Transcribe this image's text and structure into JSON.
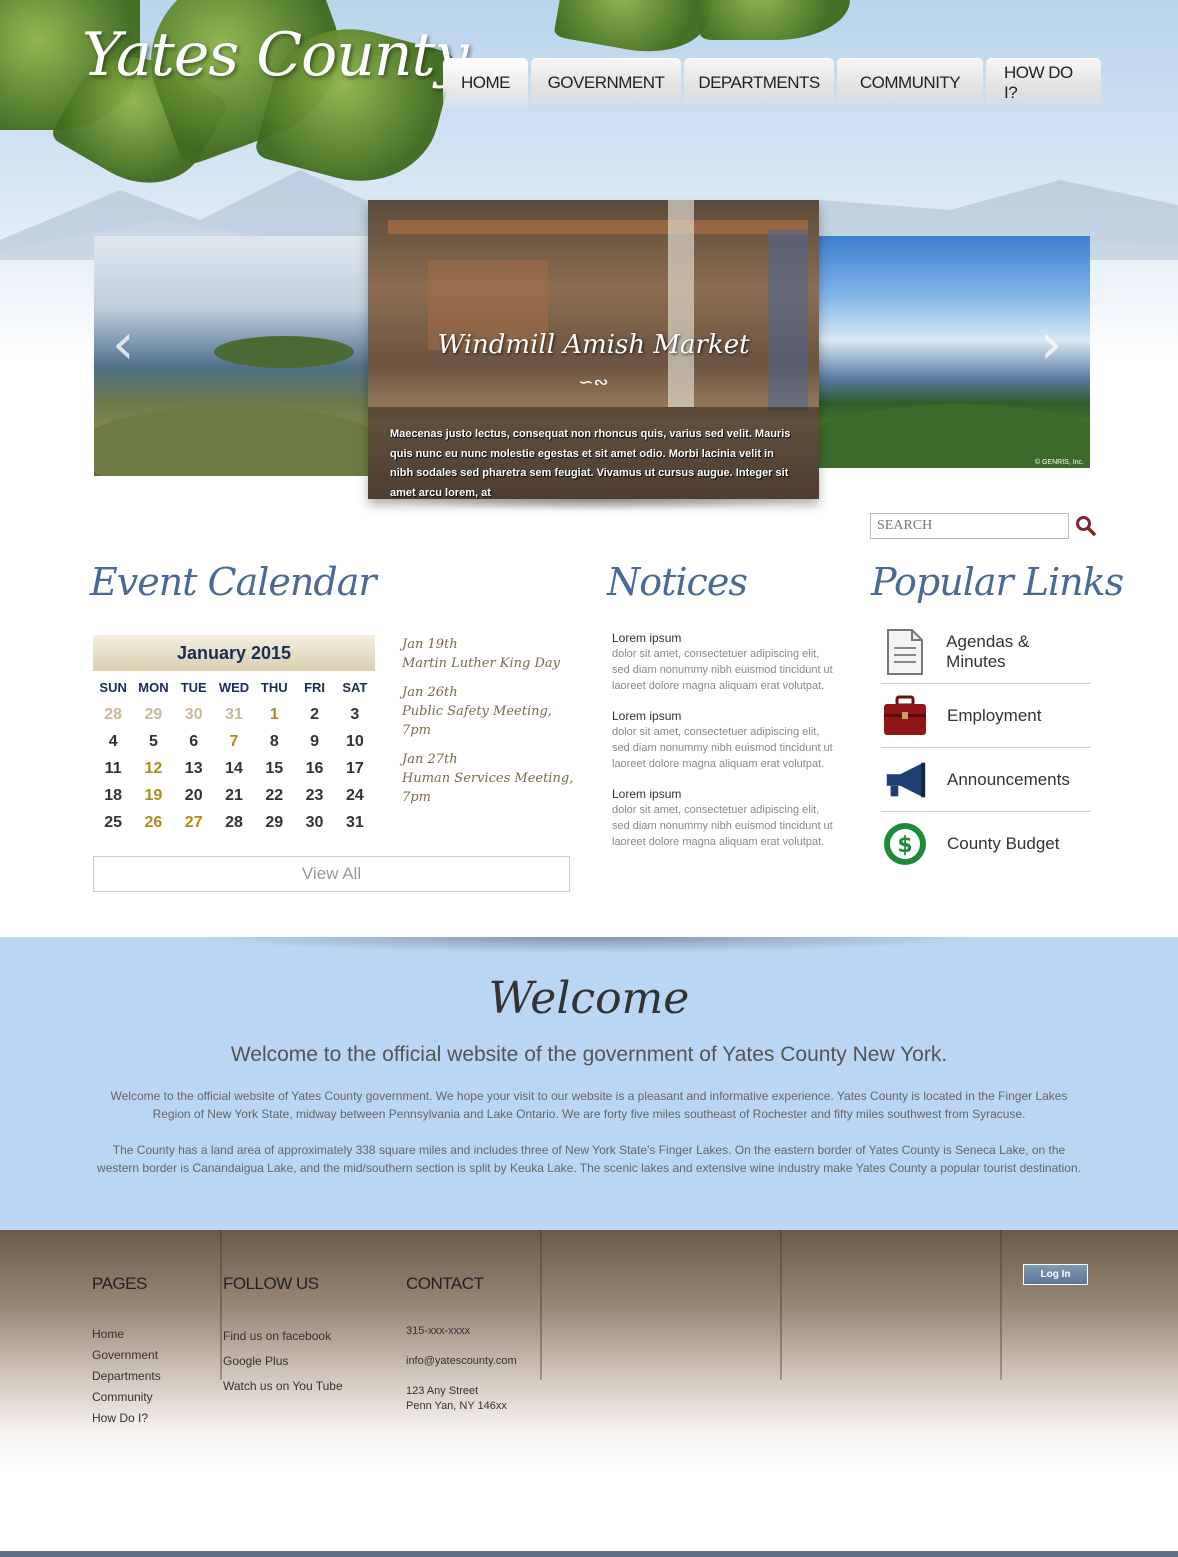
{
  "site": {
    "logo": "Yates County"
  },
  "nav": [
    {
      "label": "HOME",
      "active": true
    },
    {
      "label": "GOVERNMENT"
    },
    {
      "label": "DEPARTMENTS"
    },
    {
      "label": "COMMUNITY"
    },
    {
      "label": "HOW DO I?"
    }
  ],
  "slider": {
    "title": "Windmill Amish Market",
    "ornament": "∽∾",
    "caption": "Maecenas justo lectus, consequat non rhoncus quis, varius sed velit. Mauris quis nunc eu nunc molestie egestas et sit amet odio. Morbi lacinia velit in nibh sodales sed pharetra sem feugiat. Vivamus ut cursus augue. Integer sit amet arcu lorem, at",
    "prev_icon": "chevron-left-icon",
    "next_icon": "chevron-right-icon",
    "photo_credit": "© GENRIS, Inc."
  },
  "search": {
    "placeholder": "SEARCH"
  },
  "calendar": {
    "heading": "Event Calendar",
    "month": "January 2015",
    "days_of_week": [
      "SUN",
      "MON",
      "TUE",
      "WED",
      "THU",
      "FRI",
      "SAT"
    ],
    "cells": [
      [
        "28",
        "m"
      ],
      [
        "29",
        "m"
      ],
      [
        "30",
        "m"
      ],
      [
        "31",
        "m"
      ],
      [
        "1",
        "h"
      ],
      [
        "2",
        ""
      ],
      [
        "3",
        ""
      ],
      [
        "4",
        ""
      ],
      [
        "5",
        ""
      ],
      [
        "6",
        ""
      ],
      [
        "7",
        "h"
      ],
      [
        "8",
        ""
      ],
      [
        "9",
        ""
      ],
      [
        "10",
        ""
      ],
      [
        "11",
        ""
      ],
      [
        "12",
        "h"
      ],
      [
        "13",
        ""
      ],
      [
        "14",
        ""
      ],
      [
        "15",
        ""
      ],
      [
        "16",
        ""
      ],
      [
        "17",
        ""
      ],
      [
        "18",
        ""
      ],
      [
        "19",
        "h"
      ],
      [
        "20",
        ""
      ],
      [
        "21",
        ""
      ],
      [
        "22",
        ""
      ],
      [
        "23",
        ""
      ],
      [
        "24",
        ""
      ],
      [
        "25",
        ""
      ],
      [
        "26",
        "h"
      ],
      [
        "27",
        "h"
      ],
      [
        "28",
        ""
      ],
      [
        "29",
        ""
      ],
      [
        "30",
        ""
      ],
      [
        "31",
        ""
      ]
    ],
    "view_all": "View All"
  },
  "events": [
    {
      "date": "Jan 19th",
      "title": "Martin Luther King Day"
    },
    {
      "date": "Jan 26th",
      "title": "Public Safety Meeting, 7pm"
    },
    {
      "date": "Jan 27th",
      "title": "Human Services Meeting, 7pm"
    }
  ],
  "notices": {
    "heading": "Notices",
    "items": [
      {
        "title": "Lorem ipsum",
        "body": "dolor sit amet, consectetuer adipiscing elit, sed diam nonummy nibh euismod tincidunt ut laoreet dolore magna aliquam erat volutpat."
      },
      {
        "title": "Lorem ipsum",
        "body": "dolor sit amet, consectetuer adipiscing elit, sed diam nonummy nibh euismod tincidunt ut laoreet dolore magna aliquam erat volutpat."
      },
      {
        "title": "Lorem ipsum",
        "body": "dolor sit amet, consectetuer adipiscing elit, sed diam nonummy nibh euismod tincidunt ut laoreet dolore magna aliquam erat volutpat."
      }
    ]
  },
  "popular_links": {
    "heading": "Popular Links",
    "items": [
      {
        "label": "Agendas & Minutes",
        "icon": "document-icon"
      },
      {
        "label": "Employment",
        "icon": "briefcase-icon"
      },
      {
        "label": "Announcements",
        "icon": "megaphone-icon"
      },
      {
        "label": "County Budget",
        "icon": "dollar-icon"
      }
    ]
  },
  "welcome": {
    "title": "Welcome",
    "subtitle": "Welcome to the official website of the government of Yates County New York.",
    "p1": "Welcome to the official website of Yates County government. We hope your visit to our website is a pleasant and informative experience. Yates County is located in the Finger Lakes Region of New York State, midway between Pennsylvania and Lake Ontario. We are forty five miles southeast of Rochester and fifty miles southwest from Syracuse.",
    "p2": "The County has a land area of approximately 338 square miles and includes three of  New York State's Finger Lakes. On the eastern border of Yates County is Seneca Lake, on the western border is Canandaigua Lake, and the mid/southern section is split by Keuka Lake. The scenic lakes and extensive wine industry make Yates County a popular tourist destination."
  },
  "footer": {
    "pages_heading": "PAGES",
    "pages": [
      "Home",
      "Government",
      "Departments",
      "Community",
      "How Do I?"
    ],
    "follow_heading": "FOLLOW US",
    "follow": [
      "Find us on facebook",
      "Google Plus",
      "Watch us on You Tube"
    ],
    "contact_heading": "CONTACT",
    "phone": "315-xxx-xxxx",
    "email": "info@yatescounty.com",
    "address_line1": "123 Any Street",
    "address_line2": "Penn Yan, NY 146xx",
    "login": "Log In"
  },
  "colors": {
    "accent_blue": "#4a6a95",
    "welcome_bg": "#bad6f2",
    "highlight_day": "#b08a1a",
    "footer_bar": "#5d7183"
  }
}
